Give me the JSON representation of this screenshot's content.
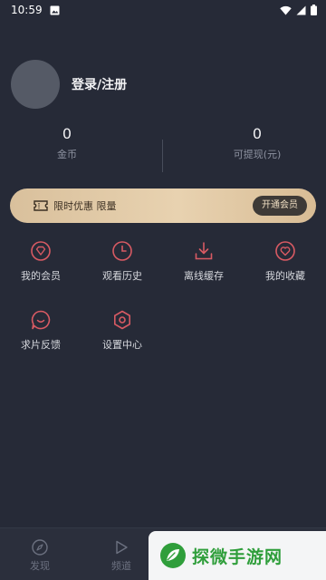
{
  "status_bar": {
    "time": "10:59"
  },
  "profile": {
    "login_label": "登录/注册"
  },
  "stats": [
    {
      "value": "0",
      "label": "金币"
    },
    {
      "value": "0",
      "label": "可提现(元)"
    }
  ],
  "vip_banner": {
    "text": "限时优惠 限量",
    "button_label": "开通会员"
  },
  "menu": [
    {
      "label": "我的会员",
      "icon": "diamond-icon"
    },
    {
      "label": "观看历史",
      "icon": "clock-icon"
    },
    {
      "label": "离线缓存",
      "icon": "download-icon"
    },
    {
      "label": "我的收藏",
      "icon": "heart-icon"
    },
    {
      "label": "求片反馈",
      "icon": "chat-icon"
    },
    {
      "label": "设置中心",
      "icon": "settings-icon"
    }
  ],
  "bottom_nav": [
    {
      "label": "发现",
      "icon": "compass-icon"
    },
    {
      "label": "频道",
      "icon": "play-icon"
    }
  ],
  "watermark": {
    "text": "探微手游网"
  },
  "colors": {
    "background": "#262a37",
    "accent": "#d85a63",
    "vip_gold": "#e0c7a2"
  }
}
